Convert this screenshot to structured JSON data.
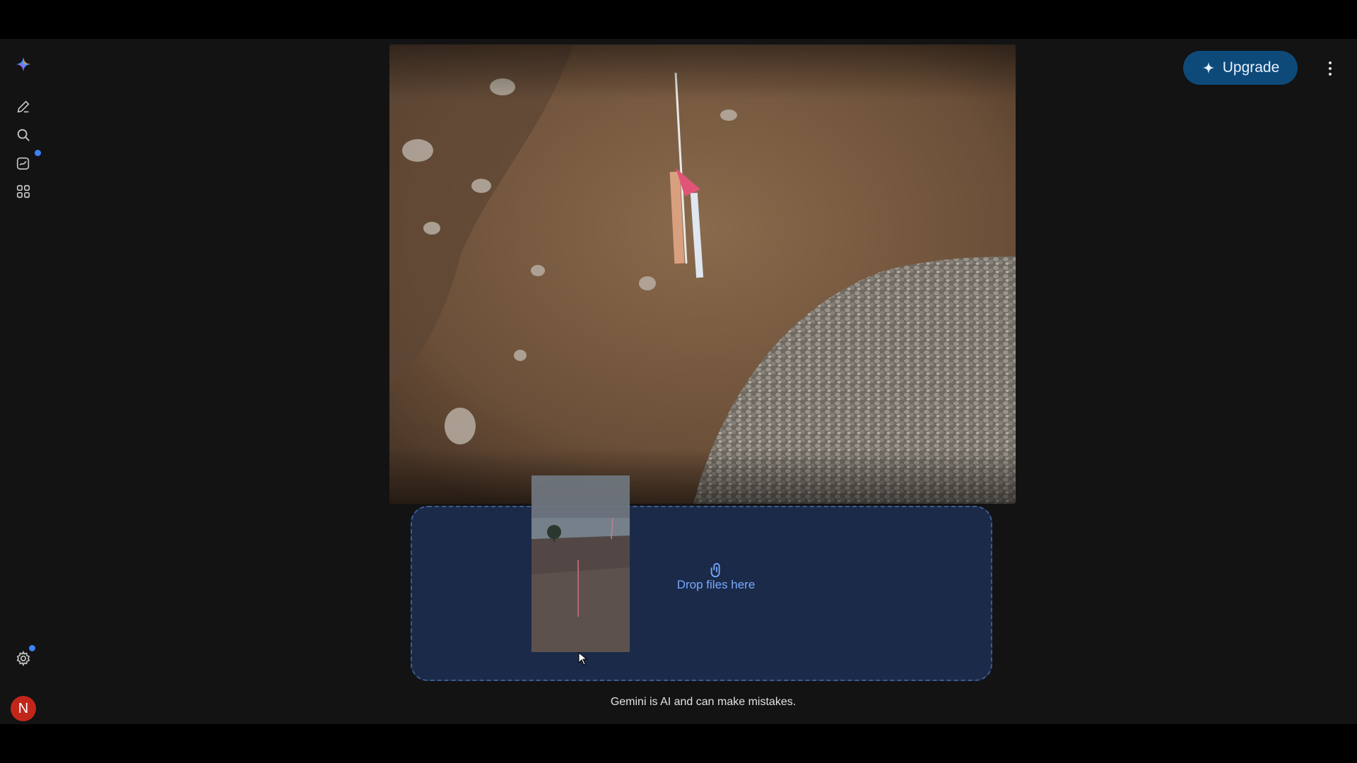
{
  "app": {
    "upgrade_label": "Upgrade",
    "disclaimer": "Gemini is AI and can make mistakes."
  },
  "sidebar": {
    "items": [
      {
        "icon": "gemini-logo-icon"
      },
      {
        "icon": "new-chat-icon"
      },
      {
        "icon": "search-icon"
      },
      {
        "icon": "gem-icon",
        "has_notification": true
      },
      {
        "icon": "apps-icon"
      }
    ],
    "settings_icon": "gear-icon",
    "avatar_initial": "N"
  },
  "dropzone": {
    "label": "Drop files here",
    "icon": "paperclip-icon"
  },
  "colors": {
    "background": "#131314",
    "upgrade_bg": "#0d4a7a",
    "dropzone_bg": "#1b2a48",
    "drop_label": "#78a9ff",
    "avatar_bg": "#c2261a",
    "notification_dot": "#3b82f6"
  }
}
